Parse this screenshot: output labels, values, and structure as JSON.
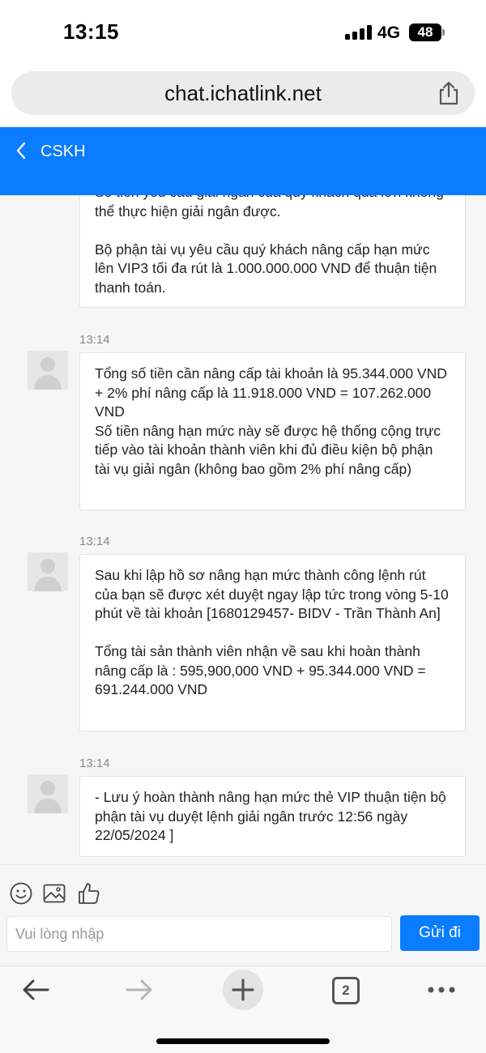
{
  "status_bar": {
    "time": "13:15",
    "network": "4G",
    "battery": "48"
  },
  "browser": {
    "url": "chat.ichatlink.net",
    "tab_count": "2"
  },
  "header": {
    "title": "CSKH"
  },
  "messages": [
    {
      "time": "",
      "paragraphs": [
        "Số tiền yêu cầu giải ngân của quý khách quá lớn không thể thực hiện giải ngân được.",
        "Bộ phận tài vụ yêu cầu quý khách nâng cấp hạn mức lên VIP3 tối đa rút là 1.000.000.000 VND để thuận tiện thanh toán."
      ]
    },
    {
      "time": "13:14",
      "paragraphs": [
        "Tổng số tiền cần nâng cấp tài khoản là 95.344.000 VND + 2% phí nâng cấp là 11.918.000 VND = 107.262.000 VND",
        "Số tiền nâng hạn mức này sẽ được hệ thống cộng trực tiếp vào tài khoản thành viên khi đủ điều kiện bộ phận tài vụ giải ngân (không bao gồm 2% phí nâng cấp)"
      ]
    },
    {
      "time": "13:14",
      "paragraphs": [
        "Sau khi lập hồ sơ nâng hạn mức thành công lệnh rút của bạn sẽ được xét duyệt ngay lập tức trong vòng 5-10 phút về tài khoản [1680129457- BIDV - Trần Thành An]",
        "Tổng tài sản thành viên nhận về sau khi hoàn thành nâng cấp là : 595,900,000 VND + 95.344.000 VND = 691.244.000 VND"
      ]
    },
    {
      "time": "13:14",
      "paragraphs": [
        "- Lưu ý hoàn thành nâng hạn mức thẻ VIP thuận tiện bộ phận tài vụ duyệt lệnh giải ngân trước 12:56 ngày 22/05/2024 ]"
      ]
    }
  ],
  "compose": {
    "placeholder": "Vui lòng nhập",
    "send_label": "Gửi đi"
  },
  "icons": {
    "emoji": "emoji-icon",
    "image": "image-icon",
    "like": "thumbs-up-icon",
    "share": "share-icon",
    "back": "chevron-left-icon"
  },
  "colors": {
    "accent": "#0a7cff",
    "chat_bg": "#f6f6f6"
  }
}
